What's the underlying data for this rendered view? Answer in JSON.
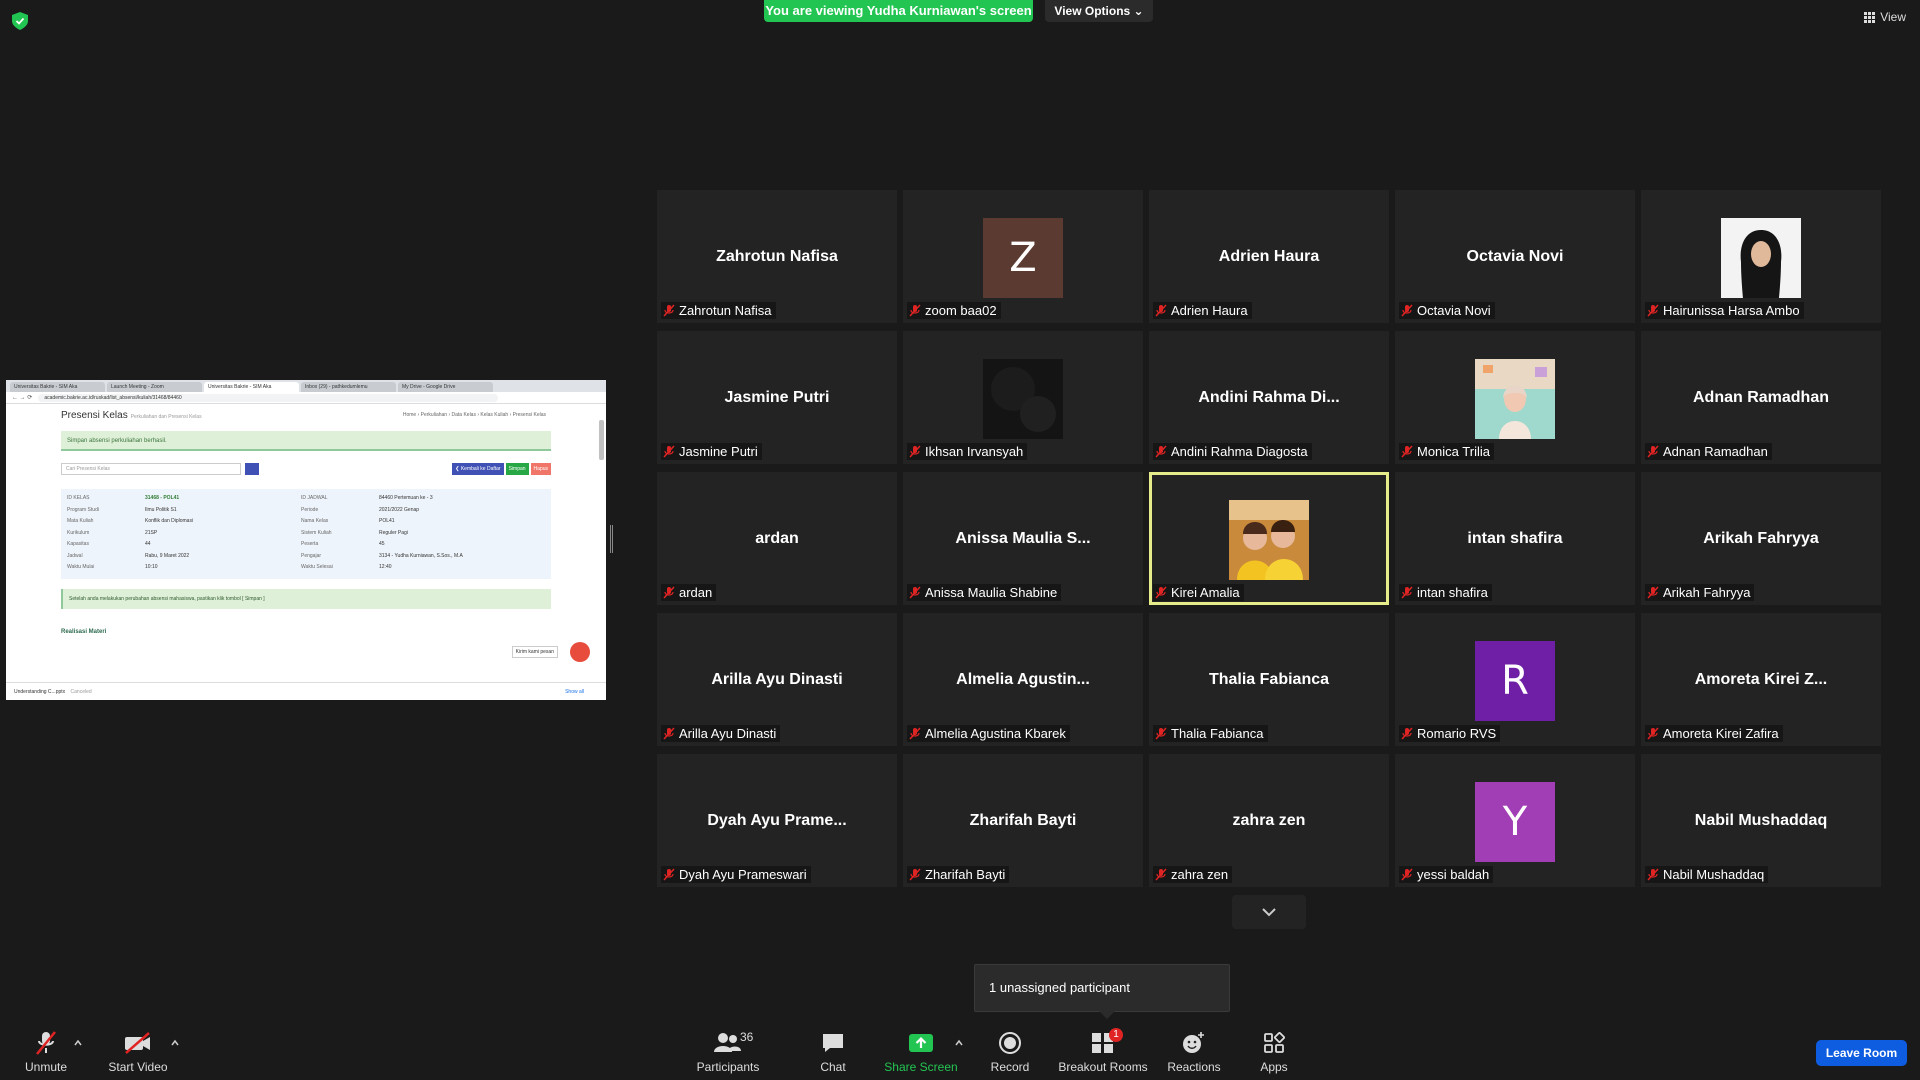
{
  "banner": {
    "viewing": "You are viewing Yudha Kurniawan's screen",
    "view_options": "View Options ⌄",
    "view": "View"
  },
  "shared_screen": {
    "tabs": [
      "Universitas Bakrie - SIM Aka",
      "Launch Meeting - Zoom",
      "Universitas Bakrie - SIM Aka",
      "Inbox (29) - pathkedumlemu",
      "My Drive - Google Drive"
    ],
    "url": "academic.bakrie.ac.id/ruskad/list_absensi/kuliah/31468/84460",
    "page_title": "Presensi Kelas",
    "page_subtitle": "Perkuliahan dan Presensi Kelas",
    "breadcrumb": "Home › Perkuliahan › Data Kelas › Kelas Kuliah › Presensi Kelas",
    "alert": "Simpan absensi perkuliahan berhasil.",
    "search_placeholder": "Cari Presensi Kelas",
    "btn_back": "❮ Kembali ke Daftar",
    "btn_save": "Simpan",
    "btn_delete": "Hapus",
    "info": [
      {
        "k": "ID KELAS",
        "v": "31468 - POL41",
        "k2": "ID JADWAL",
        "v2": "84460 Pertemuan ke - 3"
      },
      {
        "k": "Program Studi",
        "v": "Ilmu Politik S1",
        "k2": "Periode",
        "v2": "2021/2022 Genap"
      },
      {
        "k": "Mata Kuliah",
        "v": "Konflik dan Diplomasi",
        "k2": "Nama Kelas",
        "v2": "POL41"
      },
      {
        "k": "Kurikulum",
        "v": "21SP",
        "k2": "Sistem Kuliah",
        "v2": "Reguler Pagi"
      },
      {
        "k": "Kapasitas",
        "v": "44",
        "k2": "Peserta",
        "v2": "45"
      },
      {
        "k": "Jadwal",
        "v": "Rabu, 9 Maret 2022",
        "k2": "Pengajar",
        "v2": "3134 - Yudha Kurniawan, S.Sos., M.A"
      },
      {
        "k": "Waktu Mulai",
        "v": "10:10",
        "k2": "Waktu Selesai",
        "v2": "12:40"
      }
    ],
    "note": "Setelah anda melakukan perubahan absensi mahasiswa, pastikan klik tombol [ Simpan ]",
    "section": "Realisasi Materi",
    "chat_tip": "Kirim kami pesan",
    "download_file": "Understanding C...pptx",
    "download_state": "Canceled",
    "show_all": "Show all"
  },
  "participants": [
    {
      "big": "Zahrotun Nafisa",
      "label": "Zahrotun Nafisa"
    },
    {
      "letter": "Z",
      "color": "#5b3a32",
      "label": "zoom baa02"
    },
    {
      "big": "Adrien Haura",
      "label": "Adrien Haura"
    },
    {
      "big": "Octavia Novi",
      "label": "Octavia Novi"
    },
    {
      "photo": "hijab",
      "label": "Hairunissa Harsa Ambo"
    },
    {
      "big": "Jasmine Putri",
      "label": "Jasmine Putri"
    },
    {
      "photo": "dark",
      "label": "Ikhsan Irvansyah"
    },
    {
      "big": "Andini  Rahma  Di...",
      "label": "Andini Rahma Diagosta"
    },
    {
      "photo": "pastel",
      "label": "Monica Trilia"
    },
    {
      "big": "Adnan Ramadhan",
      "label": "Adnan Ramadhan"
    },
    {
      "big": "ardan",
      "label": "ardan"
    },
    {
      "big": "Anissa  Maulia  S...",
      "label": "Anissa Maulia Shabine"
    },
    {
      "photo": "yellow",
      "label": "Kirei Amalia",
      "active": true
    },
    {
      "big": "intan shafira",
      "label": "intan shafira"
    },
    {
      "big": "Arikah Fahryya",
      "label": "Arikah Fahryya"
    },
    {
      "big": "Arilla Ayu Dinasti",
      "label": "Arilla Ayu Dinasti"
    },
    {
      "big": "Almelia  Agustin...",
      "label": "Almelia Agustina Kbarek"
    },
    {
      "big": "Thalia Fabianca",
      "label": "Thalia Fabianca"
    },
    {
      "letter": "R",
      "color": "#6e1fa6",
      "label": "Romario RVS"
    },
    {
      "big": "Amoreta  Kirei  Z...",
      "label": "Amoreta Kirei Zafira"
    },
    {
      "big": "Dyah Ayu Prame...",
      "label": "Dyah Ayu Prameswari"
    },
    {
      "big": "Zharifah Bayti",
      "label": "Zharifah Bayti"
    },
    {
      "big": "zahra zen",
      "label": "zahra zen"
    },
    {
      "letter": "Y",
      "color": "#a13db5",
      "label": "yessi baldah"
    },
    {
      "big": "Nabil Mushaddaq",
      "label": "Nabil Mushaddaq"
    }
  ],
  "unassigned": "1 unassigned participant",
  "toolbar": {
    "unmute": "Unmute",
    "start_video": "Start Video",
    "participants": "Participants",
    "participants_count": "36",
    "chat": "Chat",
    "share_screen": "Share Screen",
    "record": "Record",
    "breakout_rooms": "Breakout Rooms",
    "breakout_badge": "1",
    "reactions": "Reactions",
    "apps": "Apps",
    "leave": "Leave Room"
  },
  "colors": {
    "accent_green": "#23c552",
    "leave_blue": "#0e5de0",
    "active_speaker": "#e6ec8a",
    "muted_red": "#e02424"
  }
}
